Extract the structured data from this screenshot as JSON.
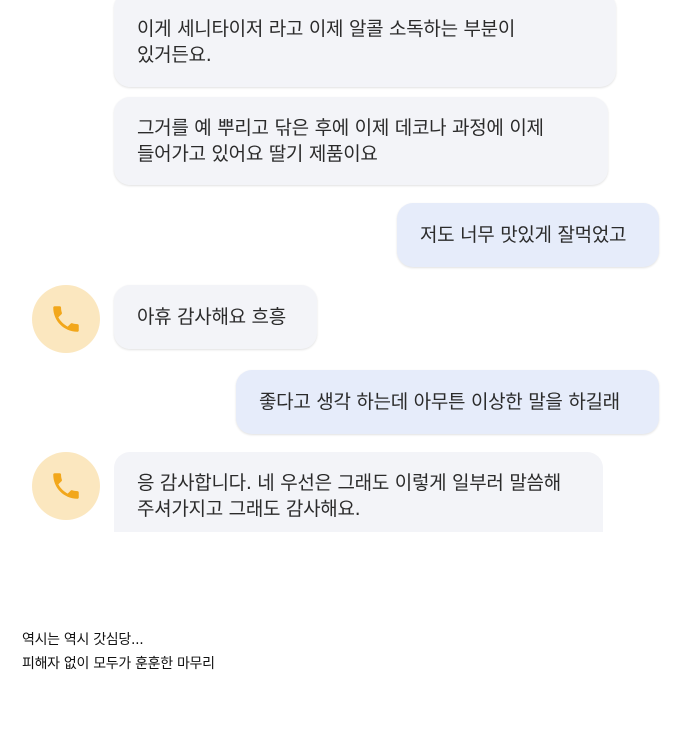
{
  "chat": {
    "messages": [
      {
        "direction": "incoming",
        "text": "이게 세니타이저 라고 이제 알콜 소독하는 부분이 있거든요."
      },
      {
        "direction": "incoming",
        "text": "그거를 예 뿌리고 닦은 후에 이제 데코나 과정에 이제 들어가고 있어요 딸기 제품이요"
      },
      {
        "direction": "outgoing",
        "text": "저도 너무 맛있게 잘먹었고"
      },
      {
        "direction": "incoming",
        "text": "아휴 감사해요 흐흥",
        "avatar_icon": "phone-icon"
      },
      {
        "direction": "outgoing",
        "text": "좋다고 생각 하는데 아무튼 이상한 말을 하길래"
      },
      {
        "direction": "incoming",
        "text": "응 감사합니다. 네 우선은 그래도 이렇게 일부러 말씀해 주셔가지고 그래도 감사해요.",
        "avatar_icon": "phone-icon"
      }
    ]
  },
  "caption": {
    "line1": "역시는 역시 갓심당...",
    "line2": "피해자 없이 모두가 훈훈한 마무리"
  },
  "colors": {
    "incoming_bubble": "#f3f4f8",
    "outgoing_bubble": "#e6ecfa",
    "avatar_bg": "#fbe7bf",
    "phone_icon": "#f2a71b"
  }
}
